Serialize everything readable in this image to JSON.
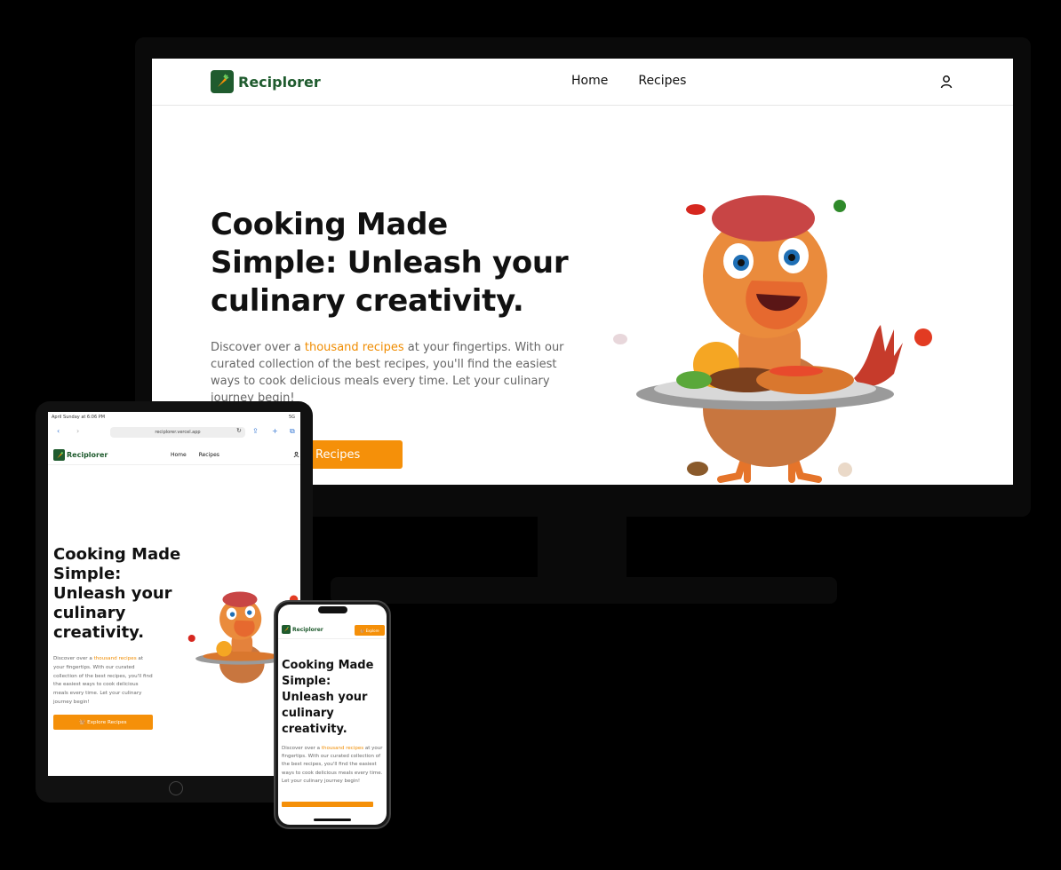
{
  "brand": {
    "name": "Reciplorer",
    "green": "#1f5b2e",
    "accent": "#f59009"
  },
  "desktop": {
    "nav": {
      "home": "Home",
      "recipes": "Recipes"
    },
    "hero": {
      "heading": "Cooking Made Simple: Unleash your culinary creativity.",
      "para_before": "Discover over a ",
      "para_highlight": "thousand recipes",
      "para_after": " at your fingertips. With our curated collection of the best recipes, you'll find the easiest ways to cook delicious meals every time. Let your culinary journey begin!",
      "button": "Recipes"
    }
  },
  "tablet": {
    "status_left": "April Sunday at 6:06 PM",
    "status_right": "5G",
    "url": "reciplorer.vercel.app",
    "aa": "AA",
    "nav": {
      "home": "Home",
      "recipes": "Recipes"
    },
    "hero": {
      "heading": "Cooking Made Simple: Unleash your culinary creativity.",
      "para_before": "Discover over a ",
      "para_highlight": "thousand recipes",
      "para_after": " at your fingertips. With our curated collection of the best recipes, you'll find the easiest ways to cook delicious meals every time. Let your culinary journey begin!",
      "button": "Explore Recipes"
    }
  },
  "phone": {
    "nav_button": "Explore",
    "hero": {
      "heading": "Cooking Made Simple: Unleash your culinary creativity.",
      "para_before": "Discover over a ",
      "para_highlight": "thousand recipes",
      "para_after": " at your fingertips. With our curated collection of the best recipes, you'll find the easiest ways to cook delicious meals every time. Let your culinary journey begin!"
    }
  },
  "icons": {
    "logo": "carrot-icon",
    "user": "user-icon",
    "mascot": "turkey-chef-mascot",
    "button_icon": "basket-icon"
  }
}
